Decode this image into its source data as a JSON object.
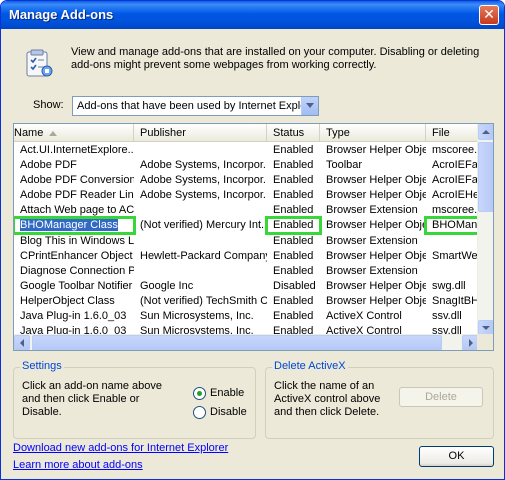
{
  "window": {
    "title": "Manage Add-ons",
    "close_glyph": "✕"
  },
  "header": {
    "icon": "addons-list-icon",
    "description": "View and manage add-ons that are installed on your computer. Disabling or deleting add-ons might prevent some webpages from working correctly."
  },
  "show": {
    "label": "Show:",
    "selected": "Add-ons that have been used by Internet Explorer"
  },
  "list": {
    "columns": [
      "Name",
      "Publisher",
      "Status",
      "Type",
      "File"
    ],
    "rows": [
      {
        "name": "Act.UI.InternetExplore...",
        "publisher": "",
        "status": "Enabled",
        "type": "Browser Helper Object",
        "file": "mscoree.d"
      },
      {
        "name": "Adobe PDF",
        "publisher": "Adobe Systems, Incorpor...",
        "status": "Enabled",
        "type": "Toolbar",
        "file": "AcroIEFav"
      },
      {
        "name": "Adobe PDF Conversion ...",
        "publisher": "Adobe Systems, Incorpor...",
        "status": "Enabled",
        "type": "Browser Helper Object",
        "file": "AcroIEFav"
      },
      {
        "name": "Adobe PDF Reader Link...",
        "publisher": "Adobe Systems, Incorpor...",
        "status": "Enabled",
        "type": "Browser Helper Object",
        "file": "AcroIEHelp"
      },
      {
        "name": "Attach Web page to AC...",
        "publisher": "",
        "status": "Enabled",
        "type": "Browser Extension",
        "file": "mscoree.d"
      },
      {
        "name": "BHOManager Class",
        "publisher": "(Not verified) Mercury Int...",
        "status": "Enabled",
        "type": "Browser Helper Object",
        "file": "BHOManag"
      },
      {
        "name": "Blog This in Windows Li...",
        "publisher": "",
        "status": "Enabled",
        "type": "Browser Extension",
        "file": ""
      },
      {
        "name": "CPrintEnhancer Object",
        "publisher": "Hewlett-Packard Company",
        "status": "Enabled",
        "type": "Browser Helper Object",
        "file": "SmartWeb"
      },
      {
        "name": "Diagnose Connection Pr...",
        "publisher": "",
        "status": "Enabled",
        "type": "Browser Extension",
        "file": ""
      },
      {
        "name": "Google Toolbar Notifier ...",
        "publisher": "Google Inc",
        "status": "Disabled",
        "type": "Browser Helper Object",
        "file": "swg.dll"
      },
      {
        "name": "HelperObject Class",
        "publisher": "(Not verified) TechSmith C...",
        "status": "Enabled",
        "type": "Browser Helper Object",
        "file": "SnagItBHO"
      },
      {
        "name": "Java Plug-in 1.6.0_03",
        "publisher": "Sun Microsystems, Inc.",
        "status": "Enabled",
        "type": "ActiveX Control",
        "file": "ssv.dll"
      },
      {
        "name": "Java Plug-in 1.6.0_03",
        "publisher": "Sun Microsystems, Inc.",
        "status": "Enabled",
        "type": "ActiveX Control",
        "file": "ssv.dll"
      }
    ]
  },
  "settings": {
    "label": "Settings",
    "instructions": "Click an add-on name above and then click Enable or Disable.",
    "enable_label": "Enable",
    "disable_label": "Disable",
    "selected": "Enable"
  },
  "delete_activex": {
    "label": "Delete ActiveX",
    "instructions": "Click the name of an ActiveX control above and then click Delete.",
    "delete_label": "Delete"
  },
  "links": {
    "download": "Download new add-ons for Internet Explorer",
    "learn": "Learn more about add-ons"
  },
  "ok_label": "OK",
  "colors": {
    "highlight": "#39d63a",
    "selection": "#316ac5",
    "link": "#0000ff"
  }
}
